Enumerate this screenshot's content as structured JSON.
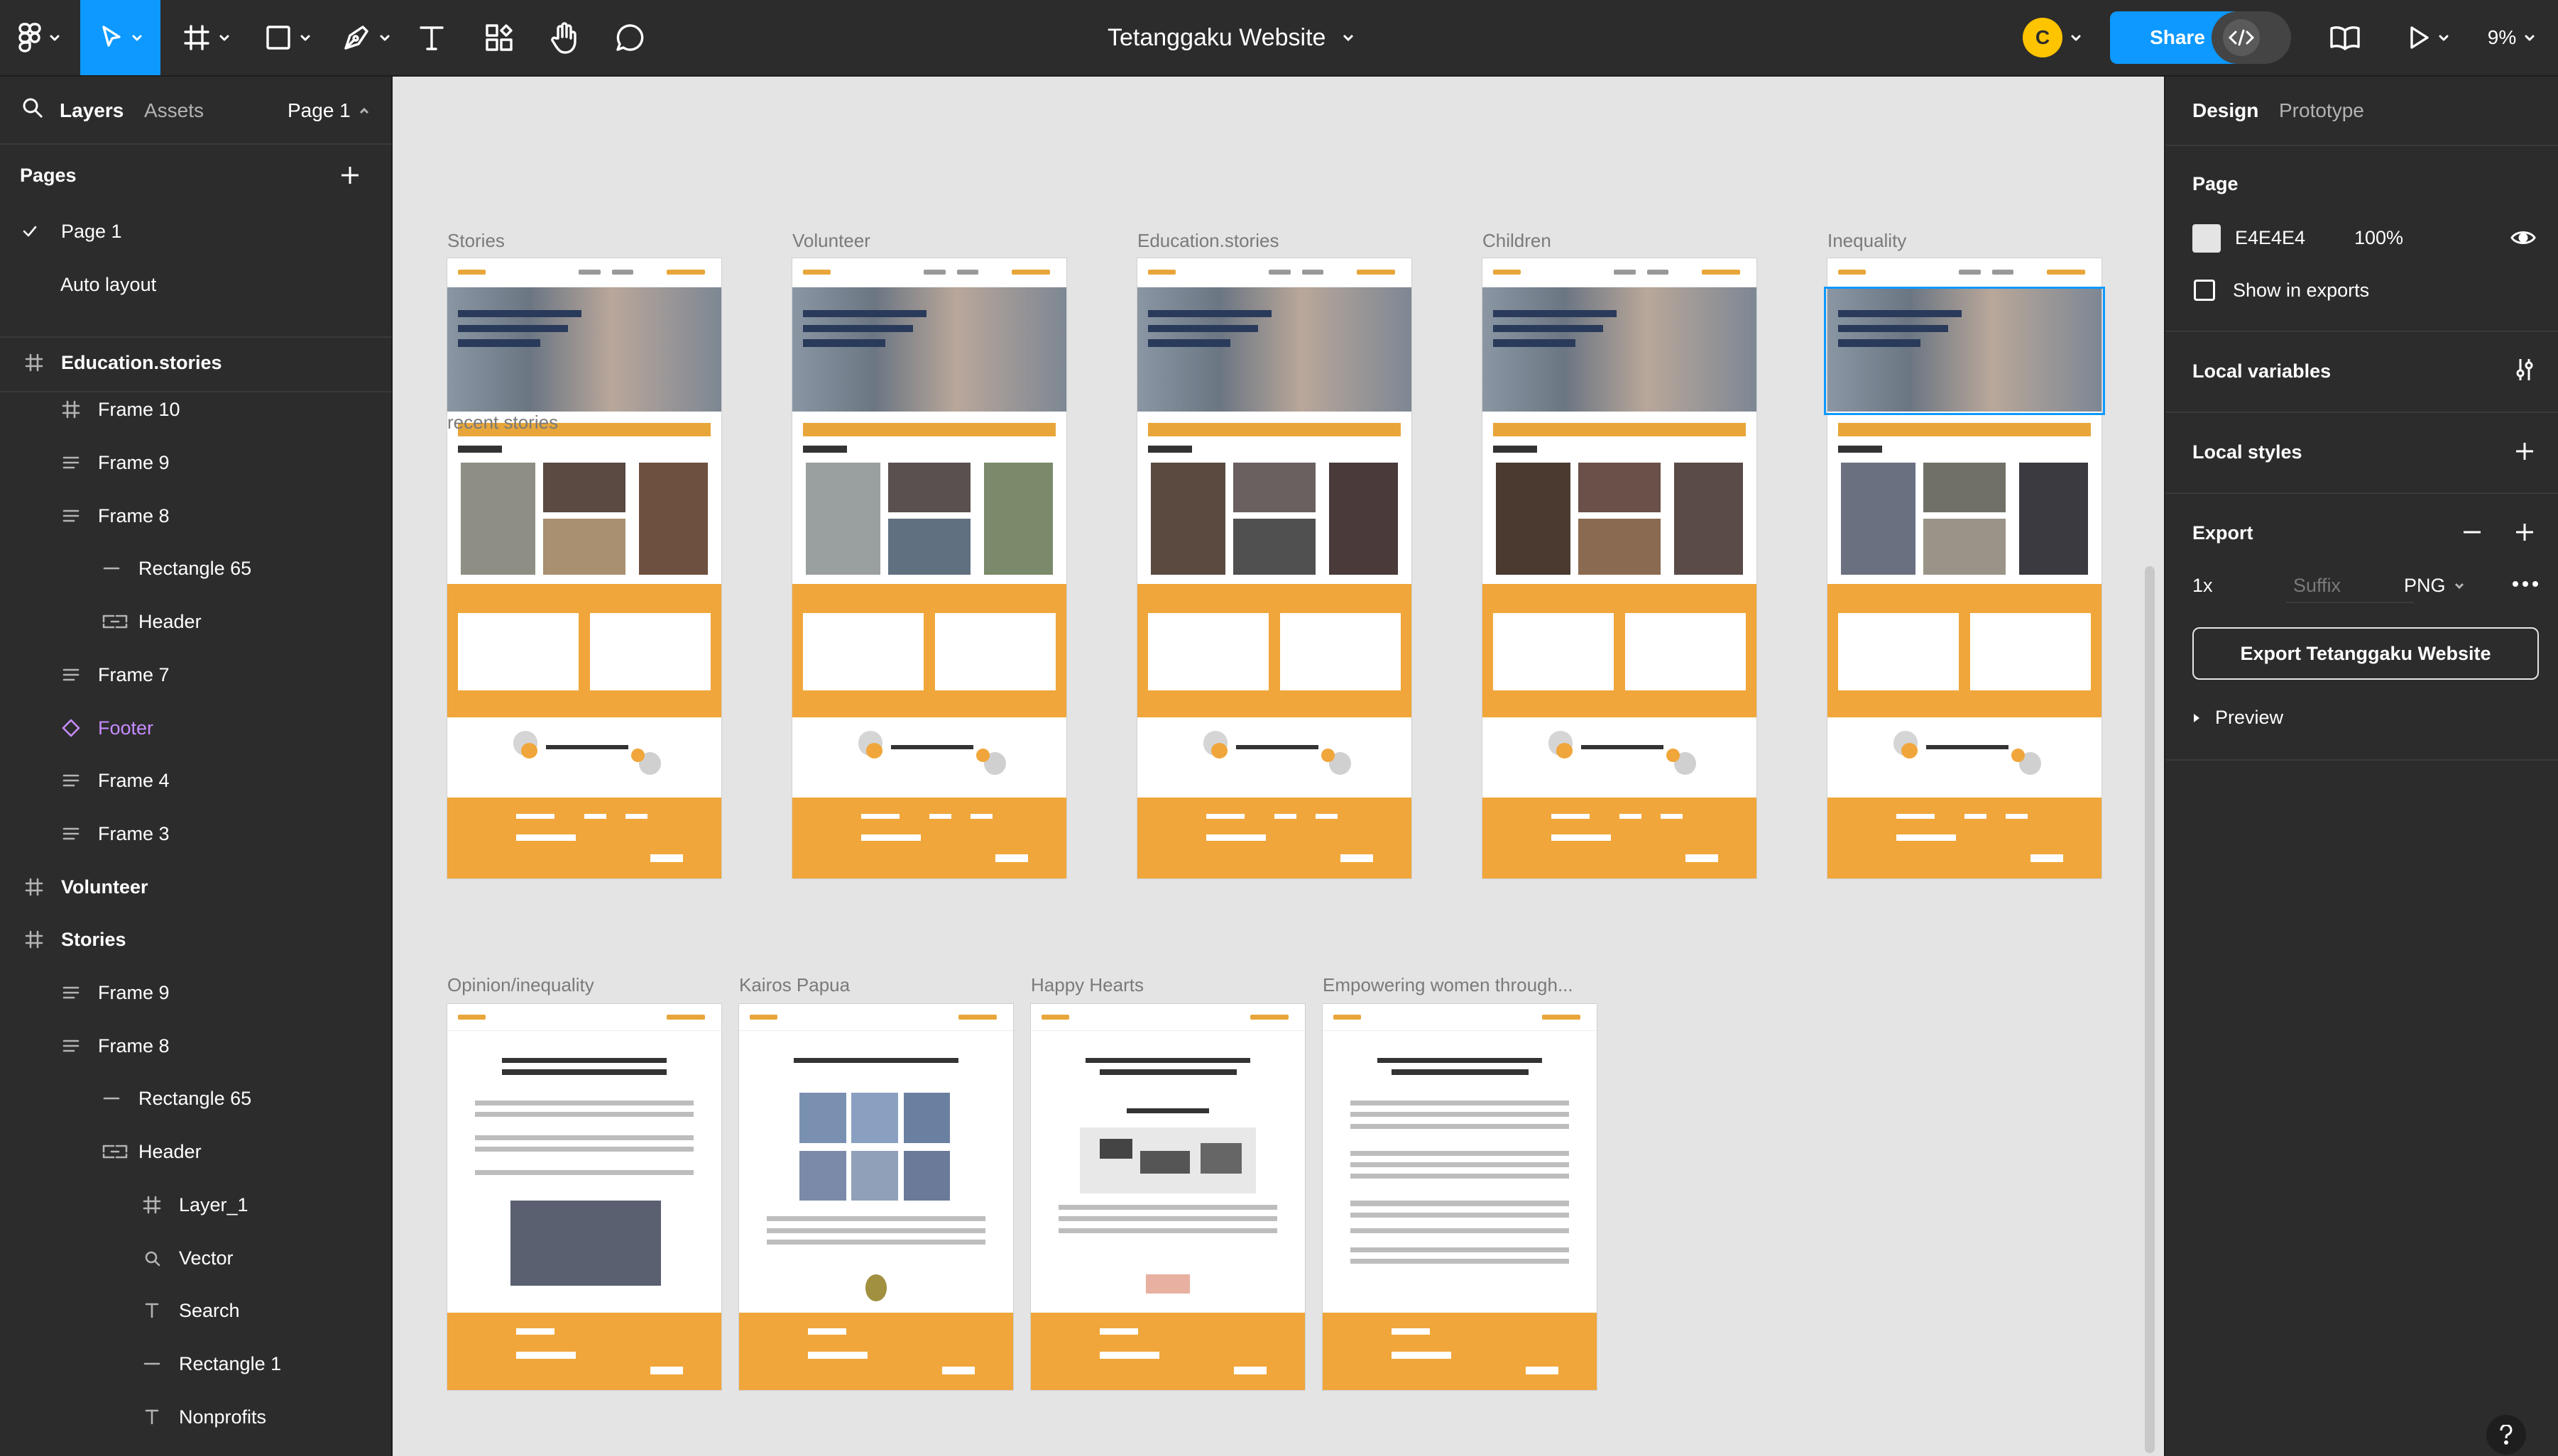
{
  "toolbar": {
    "title": "Tetanggaku Website",
    "share_label": "Share",
    "avatar_initial": "C",
    "zoom_level": "9%",
    "accent_color": "#0d99ff"
  },
  "left_panel": {
    "tabs": {
      "layers": "Layers",
      "assets": "Assets",
      "page_select": "Page 1"
    },
    "pages_heading": "Pages",
    "pages": [
      "Page 1",
      "Auto layout"
    ],
    "layers": [
      {
        "label": "Education.stories",
        "icon": "frame-icon",
        "bold": true
      },
      {
        "label": "Frame 10",
        "icon": "frame-icon"
      },
      {
        "label": "Frame 9",
        "icon": "autolayout-icon"
      },
      {
        "label": "Frame 8",
        "icon": "autolayout-icon"
      },
      {
        "label": "Rectangle 65",
        "icon": "line-icon"
      },
      {
        "label": "Header",
        "icon": "component-instance-icon"
      },
      {
        "label": "Frame 7",
        "icon": "autolayout-icon"
      },
      {
        "label": "Footer",
        "icon": "component-icon"
      },
      {
        "label": "Frame 4",
        "icon": "autolayout-icon"
      },
      {
        "label": "Frame 3",
        "icon": "autolayout-icon"
      },
      {
        "label": "Volunteer",
        "icon": "frame-icon",
        "bold": true
      },
      {
        "label": "Stories",
        "icon": "frame-icon",
        "bold": true
      },
      {
        "label": "Frame 9",
        "icon": "autolayout-icon"
      },
      {
        "label": "Frame 8",
        "icon": "autolayout-icon"
      },
      {
        "label": "Rectangle 65",
        "icon": "line-icon"
      },
      {
        "label": "Header",
        "icon": "component-instance-icon"
      },
      {
        "label": "Layer_1",
        "icon": "frame-icon"
      },
      {
        "label": "Vector",
        "icon": "vector-icon"
      },
      {
        "label": "Search",
        "icon": "text-icon"
      },
      {
        "label": "Rectangle 1",
        "icon": "line-icon"
      },
      {
        "label": "Nonprofits",
        "icon": "text-icon"
      }
    ]
  },
  "canvas": {
    "row1": [
      "Stories",
      "Volunteer",
      "Education.stories",
      "Children",
      "Inequality"
    ],
    "row2": [
      "Opinion/inequality",
      "Kairos Papua",
      "Happy Hearts",
      "Empowering women through..."
    ],
    "overlap_text": "recent stories"
  },
  "right_panel": {
    "tabs": {
      "design": "Design",
      "prototype": "Prototype"
    },
    "page_heading": "Page",
    "page_color": "E4E4E4",
    "page_opacity": "100%",
    "show_in_exports": "Show in exports",
    "local_variables": "Local variables",
    "local_styles": "Local styles",
    "export_heading": "Export",
    "export_scale": "1x",
    "export_suffix_placeholder": "Suffix",
    "export_format": "PNG",
    "export_button": "Export Tetanggaku Website",
    "preview_label": "Preview"
  }
}
